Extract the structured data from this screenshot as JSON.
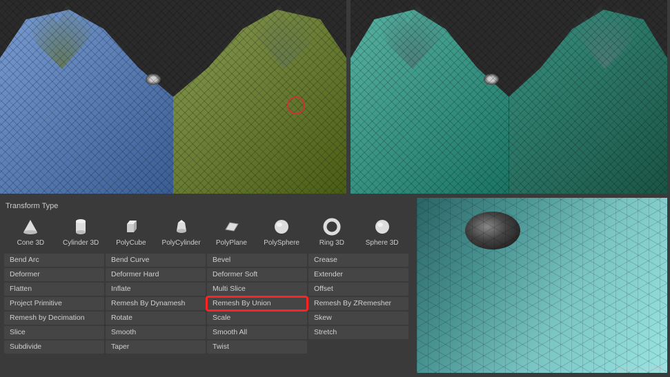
{
  "section_label": "Transform Type",
  "shapes": [
    {
      "label": "Cone 3D"
    },
    {
      "label": "Cylinder 3D"
    },
    {
      "label": "PolyCube"
    },
    {
      "label": "PolyCylinder"
    },
    {
      "label": "PolyPlane"
    },
    {
      "label": "PolySphere"
    },
    {
      "label": "Ring 3D"
    },
    {
      "label": "Sphere 3D"
    }
  ],
  "commands": [
    "Bend Arc",
    "Bend Curve",
    "Bevel",
    "Crease",
    "Deformer",
    "Deformer Hard",
    "Deformer Soft",
    "Extender",
    "Flatten",
    "Inflate",
    "Multi Slice",
    "Offset",
    "Project Primitive",
    "Remesh By Dynamesh",
    "Remesh By Union",
    "Remesh By ZRemesher",
    "Remesh by Decimation",
    "Rotate",
    "Scale",
    "Skew",
    "Slice",
    "Smooth",
    "Smooth All",
    "Stretch",
    "Subdivide",
    "Taper",
    "Twist"
  ],
  "highlighted_command": "Remesh By Union",
  "watermark": "@51CTO博客"
}
